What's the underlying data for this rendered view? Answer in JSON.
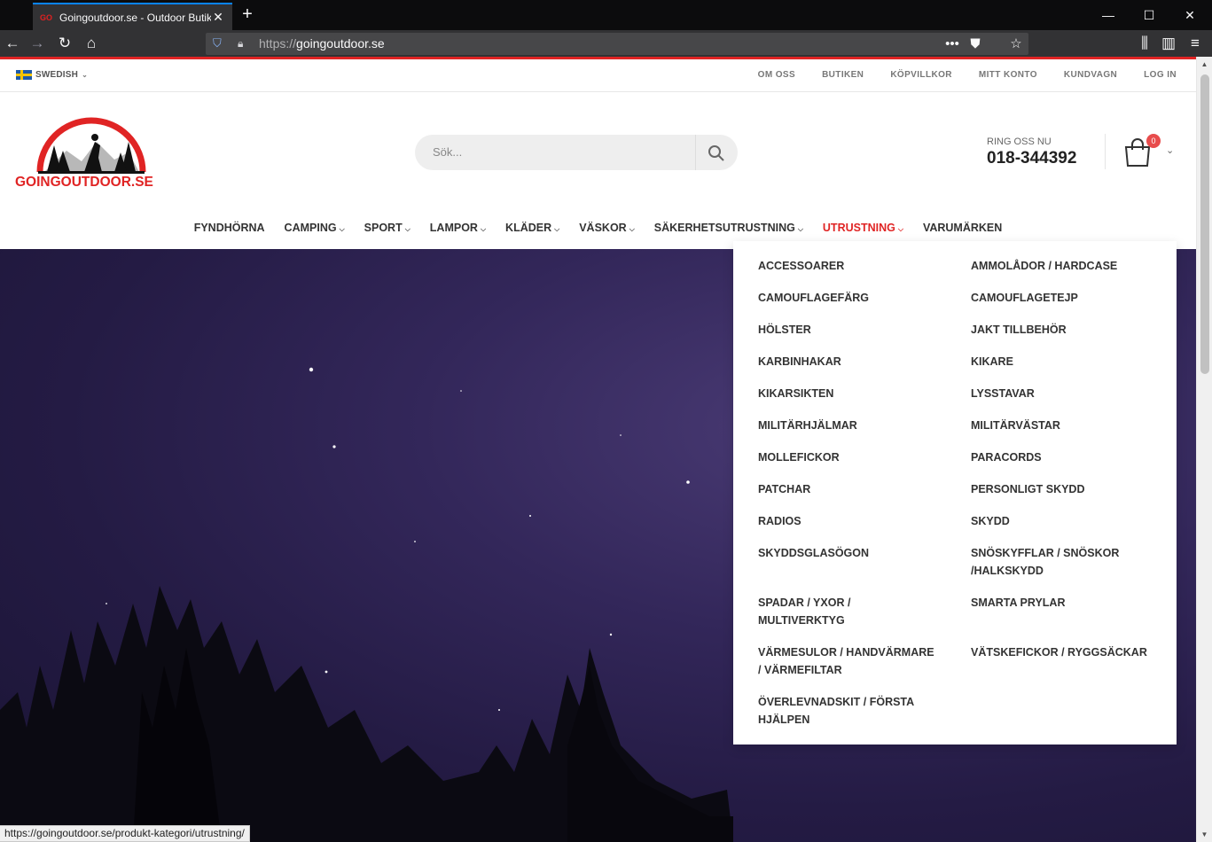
{
  "browser": {
    "tab_title": "Goingoutdoor.se - Outdoor Butik",
    "favicon_text": "GO",
    "url_scheme": "https://",
    "url_host": "goingoutdoor.se",
    "status_url": "https://goingoutdoor.se/produkt-kategori/utrustning/"
  },
  "topbar": {
    "language": "SWEDISH",
    "links": [
      "OM OSS",
      "BUTIKEN",
      "KÖPVILLKOR",
      "MITT KONTO",
      "KUNDVAGN",
      "LOG IN"
    ]
  },
  "header": {
    "logo_text": "GOINGOUTDOOR.SE",
    "search_placeholder": "Sök...",
    "phone_label": "RING OSS NU",
    "phone_number": "018-344392",
    "cart_count": "0"
  },
  "nav": [
    {
      "label": "FYNDHÖRNA",
      "dropdown": false
    },
    {
      "label": "CAMPING",
      "dropdown": true
    },
    {
      "label": "SPORT",
      "dropdown": true
    },
    {
      "label": "LAMPOR",
      "dropdown": true
    },
    {
      "label": "KLÄDER",
      "dropdown": true
    },
    {
      "label": "VÄSKOR",
      "dropdown": true
    },
    {
      "label": "SÄKERHETSUTRUSTNING",
      "dropdown": true
    },
    {
      "label": "UTRUSTNING",
      "dropdown": true,
      "active": true
    },
    {
      "label": "VARUMÄRKEN",
      "dropdown": false
    }
  ],
  "dropdown": {
    "left": [
      "ACCESSOARER",
      "CAMOUFLAGEFÄRG",
      "HÖLSTER",
      "KARBINHAKAR",
      "KIKARSIKTEN",
      "MILITÄRHJÄLMAR",
      "MOLLEFICKOR",
      "PATCHAR",
      "RADIOS",
      "SKYDDSGLASÖGON",
      "SPADAR / YXOR / MULTIVERKTYG",
      "VÄRMESULOR / HANDVÄRMARE / VÄRMEFILTAR",
      "ÖVERLEVNADSKIT / FÖRSTA HJÄLPEN"
    ],
    "right": [
      "AMMOLÅDOR / HARDCASE",
      "CAMOUFLAGETEJP",
      "JAKT TILLBEHÖR",
      "KIKARE",
      "LYSSTAVAR",
      "MILITÄRVÄSTAR",
      "PARACORDS",
      "PERSONLIGT SKYDD",
      "SKYDD",
      "SNÖSKYFFLAR / SNÖSKOR /HALKSKYDD",
      "SMARTA PRYLAR",
      "VÄTSKEFICKOR / RYGGSÄCKAR"
    ]
  },
  "colors": {
    "accent": "#e02424",
    "hero_sky": "#2a2050"
  }
}
